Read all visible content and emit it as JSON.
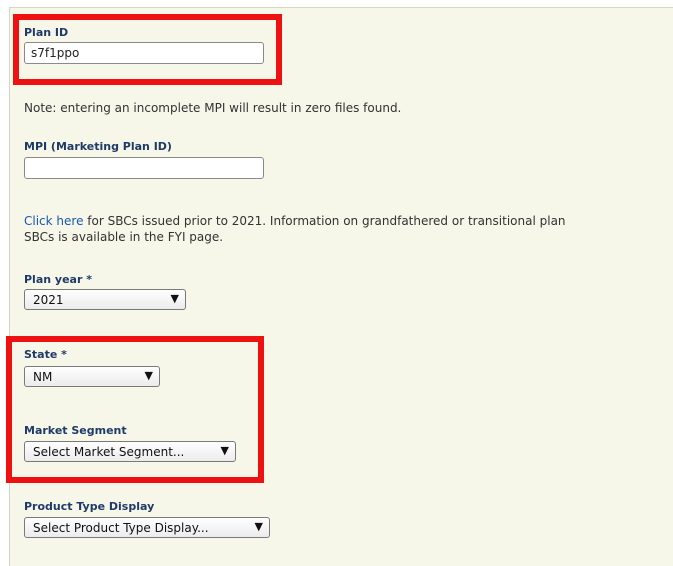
{
  "plan_id": {
    "label": "Plan ID",
    "value": "s7f1ppo"
  },
  "note": "Note: entering an incomplete MPI will result in zero files found.",
  "mpi": {
    "label": "MPI (Marketing Plan ID)",
    "value": ""
  },
  "info": {
    "link": "Click here",
    "line1": " for SBCs issued prior to 2021. Information on grandfathered or transitional plan",
    "line2": "SBCs is available in the FYI page."
  },
  "plan_year": {
    "label": "Plan year *",
    "value": "2021"
  },
  "state": {
    "label": "State *",
    "value": "NM"
  },
  "market_segment": {
    "label": "Market Segment",
    "value": "Select Market Segment..."
  },
  "product_type": {
    "label": "Product Type Display",
    "value": "Select Product Type Display..."
  },
  "icons": {
    "dropdown": "▼"
  },
  "colors": {
    "highlight": "#ee1111",
    "link": "#1a57b3",
    "label": "#1f3a68",
    "panel": "#f6f6e9"
  }
}
